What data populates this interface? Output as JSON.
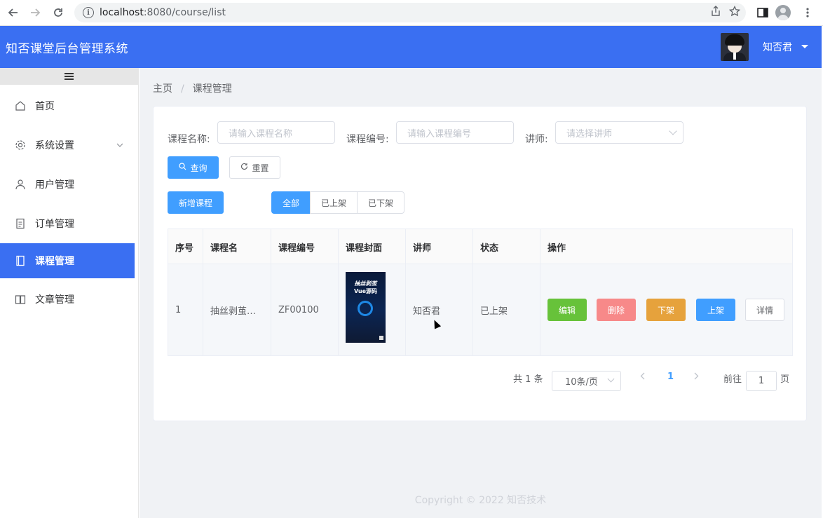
{
  "browser": {
    "url_host": "localhost",
    "url_path": ":8080/course/list"
  },
  "app": {
    "title": "知否课堂后台管理系统",
    "user_name": "知否君"
  },
  "sidebar": {
    "items": [
      {
        "label": "首页",
        "icon": "home-icon"
      },
      {
        "label": "系统设置",
        "icon": "gear-icon"
      },
      {
        "label": "用户管理",
        "icon": "user-icon"
      },
      {
        "label": "订单管理",
        "icon": "document-icon"
      },
      {
        "label": "课程管理",
        "icon": "notebook-icon",
        "active": true
      },
      {
        "label": "文章管理",
        "icon": "book-icon"
      }
    ]
  },
  "breadcrumb": {
    "home": "主页",
    "sep": "/",
    "current": "课程管理"
  },
  "filters": {
    "course_name_label": "课程名称:",
    "course_name_placeholder": "请输入课程名称",
    "course_code_label": "课程编号:",
    "course_code_placeholder": "请输入课程编号",
    "teacher_label": "讲师:",
    "teacher_placeholder": "请选择讲师",
    "search_label": "查询",
    "reset_label": "重置"
  },
  "actions": {
    "add_label": "新增课程",
    "tabs": [
      "全部",
      "已上架",
      "已下架"
    ]
  },
  "table": {
    "headers": [
      "序号",
      "课程名",
      "课程编号",
      "课程封面",
      "讲师",
      "状态",
      "操作"
    ],
    "rows": [
      {
        "index": "1",
        "name": "抽丝剥茧…",
        "code": "ZF00100",
        "cover_title1": "抽丝剥茧",
        "cover_title2": "Vue源码",
        "teacher": "知否君",
        "status": "已上架"
      }
    ],
    "ops": [
      "编辑",
      "删除",
      "下架",
      "上架",
      "详情"
    ]
  },
  "pagination": {
    "total": "共 1 条",
    "page_size": "10条/页",
    "current_page": "1",
    "goto_label": "前往",
    "goto_value": "1",
    "page_suffix": "页"
  },
  "footer": "Copyright © 2022 知否技术",
  "colors": {
    "header": "#3a6ff2",
    "primary": "#409eff",
    "success": "#67c23a",
    "danger": "#f56c6c",
    "warning": "#e6a23c"
  }
}
